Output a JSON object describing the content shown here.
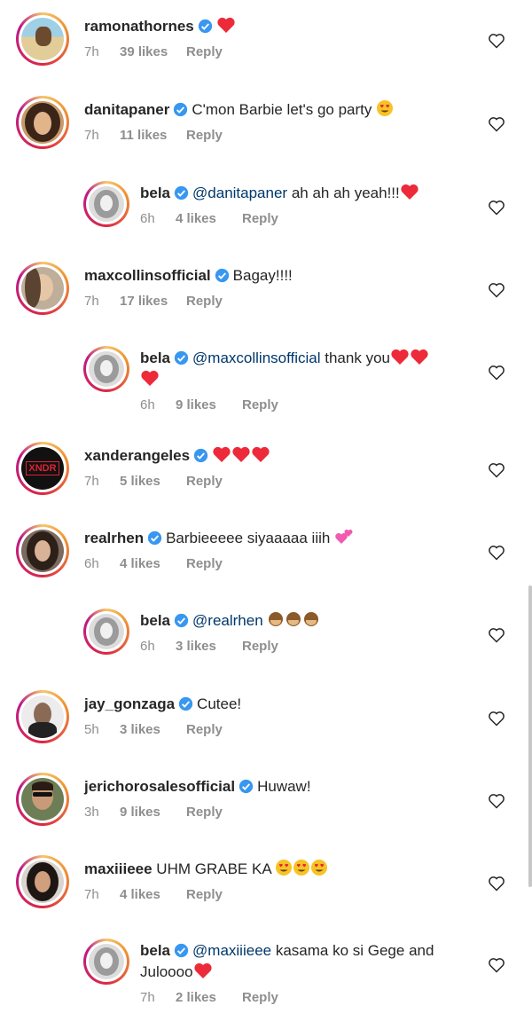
{
  "comments": [
    {
      "username": "ramonathornes",
      "text": "",
      "emojis": [
        "red-heart"
      ],
      "time": "7h",
      "likes": "39 likes",
      "reply": "Reply",
      "avatar": "beach"
    },
    {
      "username": "danitapaner",
      "text": "C'mon Barbie let's go party",
      "emojis": [
        "heart-eyes"
      ],
      "time": "7h",
      "likes": "11 likes",
      "reply": "Reply",
      "avatar": "woman"
    },
    {
      "username": "bela",
      "mention": "@danitapaner",
      "text": " ah ah ah yeah!!!",
      "emojis": [
        "red-heart"
      ],
      "time": "6h",
      "likes": "4 likes",
      "reply": "Reply",
      "avatar": "bela"
    },
    {
      "username": "maxcollinsofficial",
      "text": "Bagay!!!!",
      "emojis": [],
      "time": "7h",
      "likes": "17 likes",
      "reply": "Reply",
      "avatar": "woman2"
    },
    {
      "username": "bela",
      "mention": "@maxcollinsofficial",
      "text": " thank you",
      "emojis": [
        "red-heart",
        "red-heart",
        "red-heart"
      ],
      "time": "6h",
      "likes": "9 likes",
      "reply": "Reply",
      "avatar": "bela"
    },
    {
      "username": "xanderangeles",
      "text": "",
      "emojis": [
        "red-heart",
        "red-heart",
        "red-heart"
      ],
      "time": "7h",
      "likes": "5 likes",
      "reply": "Reply",
      "avatar": "xndr",
      "avatar_text": "XNDR"
    },
    {
      "username": "realrhen",
      "text": "Barbieeeee siyaaaaa iiih",
      "emojis": [
        "two-hearts"
      ],
      "time": "6h",
      "likes": "4 likes",
      "reply": "Reply",
      "avatar": "woman3"
    },
    {
      "username": "bela",
      "mention": "@realrhen",
      "text": "",
      "emojis": [
        "monkey",
        "monkey",
        "monkey"
      ],
      "time": "6h",
      "likes": "3 likes",
      "reply": "Reply",
      "avatar": "bela"
    },
    {
      "username": "jay_gonzaga",
      "text": "Cutee!",
      "emojis": [],
      "time": "5h",
      "likes": "3 likes",
      "reply": "Reply",
      "avatar": "man"
    },
    {
      "username": "jerichorosalesofficial",
      "text": "Huwaw!",
      "emojis": [],
      "time": "3h",
      "likes": "9 likes",
      "reply": "Reply",
      "avatar": "man2"
    },
    {
      "username": "maxiiieee",
      "text": "UHM GRABE KA",
      "emojis": [
        "heart-eyes",
        "heart-eyes",
        "heart-eyes"
      ],
      "time": "7h",
      "likes": "4 likes",
      "reply": "Reply",
      "avatar": "woman4"
    },
    {
      "username": "bela",
      "mention": "@maxiiieee",
      "text": " kasama ko si Gege and Juloooo",
      "emojis": [
        "red-heart"
      ],
      "time": "7h",
      "likes": "2 likes",
      "reply": "Reply",
      "avatar": "bela"
    }
  ],
  "colors": {
    "text": "#262626",
    "meta": "#8e8e8e",
    "mention": "#00376b",
    "verified": "#3897f0",
    "heart": "#ed2a3a"
  }
}
